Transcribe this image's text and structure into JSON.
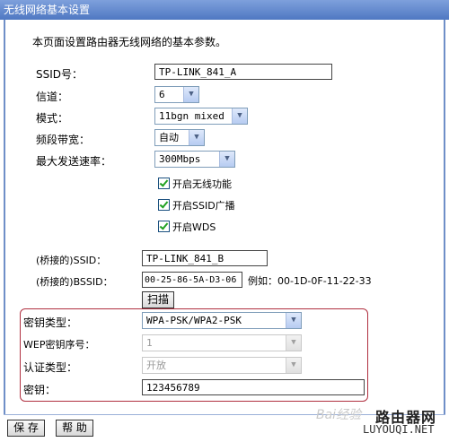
{
  "window": {
    "title": "无线网络基本设置"
  },
  "description": "本页面设置路由器无线网络的基本参数。",
  "ssid": {
    "label": "SSID号：",
    "value": "TP-LINK_841_A"
  },
  "channel": {
    "label": "信道：",
    "value": "6"
  },
  "mode": {
    "label": "模式：",
    "value": "11bgn mixed"
  },
  "bandwidth": {
    "label": "频段带宽：",
    "value": "自动"
  },
  "max_rate": {
    "label": "最大发送速率：",
    "value": "300Mbps"
  },
  "checkboxes": [
    {
      "label": "开启无线功能",
      "checked": true
    },
    {
      "label": "开启SSID广播",
      "checked": true
    },
    {
      "label": "开启WDS",
      "checked": true
    }
  ],
  "bridge_ssid": {
    "label": "(桥接的)SSID：",
    "value": "TP-LINK_841_B"
  },
  "bridge_bssid": {
    "label": "(桥接的)BSSID：",
    "value": "00-25-86-5A-D3-06",
    "example": "例如：00-1D-0F-11-22-33"
  },
  "scan_button": "扫描",
  "key_type": {
    "label": "密钥类型：",
    "value": "WPA-PSK/WPA2-PSK"
  },
  "wep_index": {
    "label": "WEP密钥序号：",
    "value": "1"
  },
  "auth_type": {
    "label": "认证类型：",
    "value": "开放"
  },
  "key": {
    "label": "密钥：",
    "value": "123456789"
  },
  "buttons": {
    "save": "保 存",
    "help": "帮 助"
  },
  "watermark": {
    "baidu": "Bai经验",
    "brand_cn": "路由器网",
    "brand_url": "LUYOUQI.NET"
  },
  "colors": {
    "titlebar": "#5a82c8",
    "highlight_box": "#b03040",
    "checkmark": "#21a121"
  }
}
